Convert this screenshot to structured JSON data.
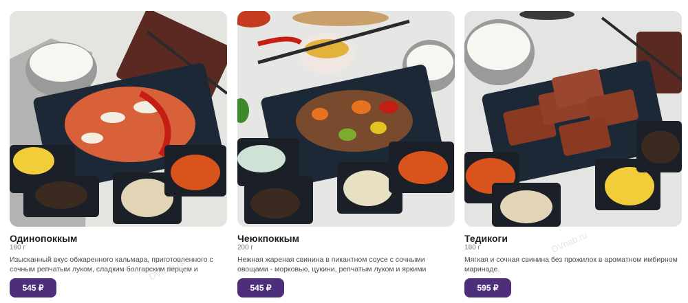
{
  "watermark": "DVhab.ru",
  "products": [
    {
      "name": "Одинопоккым",
      "weight": "180 г",
      "description": "Изысканный вкус обжаренного кальмара, приготовленного с сочным репчатым луком, сладким болгарским перцем и",
      "price": "545 ₽",
      "image": "squid-stir-fry-photo"
    },
    {
      "name": "Чеюкпоккым",
      "weight": "200 г",
      "description": "Нежная жареная свинина в пикантном соусе с сочными овощами - морковью, цукини, репчатым луком и яркими",
      "price": "545 ₽",
      "image": "spicy-pork-stir-fry-photo"
    },
    {
      "name": "Тедикоги",
      "weight": "180 г",
      "description": "Мягкая и сочная свинина без прожилок в ароматном имбирном маринаде.",
      "price": "595 ₽",
      "image": "ginger-pork-photo"
    }
  ]
}
